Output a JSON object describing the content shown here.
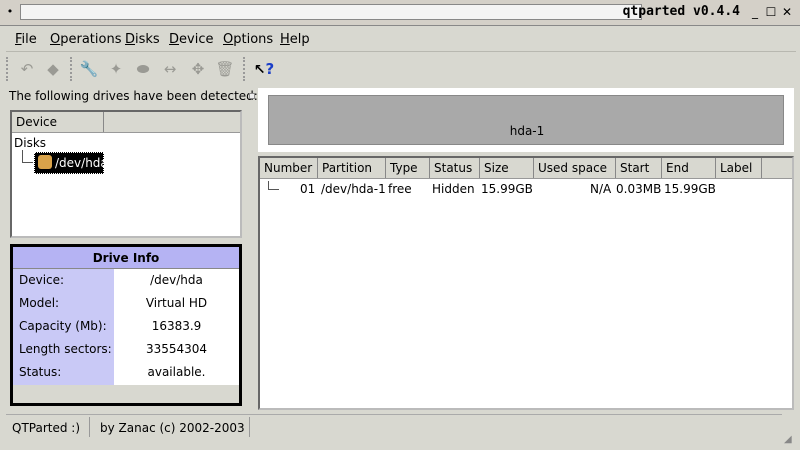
{
  "window": {
    "title": "qtparted v0.4.4",
    "sys_menu": "•",
    "controls": {
      "minimize": "_",
      "maximize": "☐",
      "close": "✕"
    }
  },
  "menubar": {
    "items": [
      {
        "label": "File",
        "mnemonic": "F",
        "rest": "ile"
      },
      {
        "label": "Operations",
        "mnemonic": "O",
        "rest": "perations"
      },
      {
        "label": "Disks",
        "mnemonic": "D",
        "rest": "isks"
      },
      {
        "label": "Device",
        "mnemonic": "D",
        "rest": "evice"
      },
      {
        "label": "Options",
        "mnemonic": "O",
        "rest": "ptions"
      },
      {
        "label": "Help",
        "mnemonic": "H",
        "rest": "elp"
      }
    ]
  },
  "toolbar": {
    "icons": [
      {
        "name": "undo-icon",
        "glyph": "↶"
      },
      {
        "name": "commit-icon",
        "glyph": "◆"
      },
      {
        "name": "wrench-icon",
        "glyph": "🔧"
      },
      {
        "name": "new-partition-icon",
        "glyph": "✦"
      },
      {
        "name": "eraser-icon",
        "glyph": "⬬"
      },
      {
        "name": "resize-icon",
        "glyph": "↔"
      },
      {
        "name": "move-icon",
        "glyph": "✥"
      },
      {
        "name": "trash-icon",
        "glyph": "🗑"
      },
      {
        "name": "whats-this-icon",
        "glyph": "?"
      }
    ]
  },
  "left_panel": {
    "detected_label": "The following drives have been detected:",
    "tree": {
      "column_header": "Device",
      "root_label": "Disks",
      "device_label": "/dev/hda"
    }
  },
  "drive_info": {
    "title": "Drive Info",
    "rows": [
      {
        "key": "Device:",
        "value": "/dev/hda"
      },
      {
        "key": "Model:",
        "value": "Virtual HD"
      },
      {
        "key": "Capacity (Mb):",
        "value": "16383.9"
      },
      {
        "key": "Length sectors:",
        "value": "33554304"
      },
      {
        "key": "Status:",
        "value": "available."
      }
    ]
  },
  "disk_graph": {
    "partition_label": "hda-1"
  },
  "partition_table": {
    "columns": [
      "Number",
      "Partition",
      "Type",
      "Status",
      "Size",
      "Used space",
      "Start",
      "End",
      "Label"
    ],
    "rows": [
      {
        "number": "01",
        "partition": "/dev/hda-1",
        "type": "free",
        "status": "Hidden",
        "size": "15.99GB",
        "used_space": "N/A",
        "start": "0.03MB",
        "end": "15.99GB",
        "label": ""
      }
    ]
  },
  "statusbar": {
    "app": "QTParted :)",
    "credit": "by Zanac (c) 2002-2003"
  },
  "colors": {
    "background": "#d8d8d0",
    "drive_info_header": "#b5b3f3",
    "drive_info_keys": "#c9c9f6",
    "partition_bar": "#a9a9a9",
    "selection": "#000000"
  }
}
